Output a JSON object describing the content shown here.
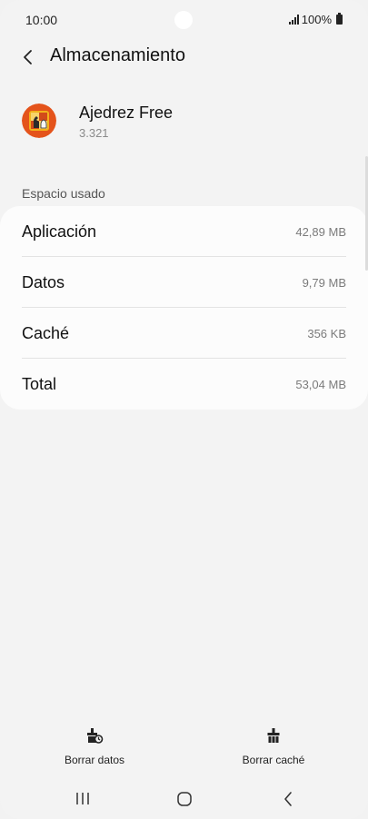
{
  "status_bar": {
    "time": "10:00",
    "battery": "100%"
  },
  "header": {
    "title": "Almacenamiento"
  },
  "app": {
    "name": "Ajedrez Free",
    "version": "3.321",
    "icon": "chess-app-icon"
  },
  "storage": {
    "section_title": "Espacio usado",
    "rows": [
      {
        "label": "Aplicación",
        "value": "42,89 MB"
      },
      {
        "label": "Datos",
        "value": "9,79 MB"
      },
      {
        "label": "Caché",
        "value": "356 KB"
      },
      {
        "label": "Total",
        "value": "53,04 MB"
      }
    ]
  },
  "actions": {
    "clear_data": "Borrar datos",
    "clear_cache": "Borrar caché"
  },
  "colors": {
    "background": "#f3f3f3",
    "card": "#fcfcfc",
    "app_icon_orange": "#e4531b",
    "app_icon_yellow": "#f2b21c"
  }
}
